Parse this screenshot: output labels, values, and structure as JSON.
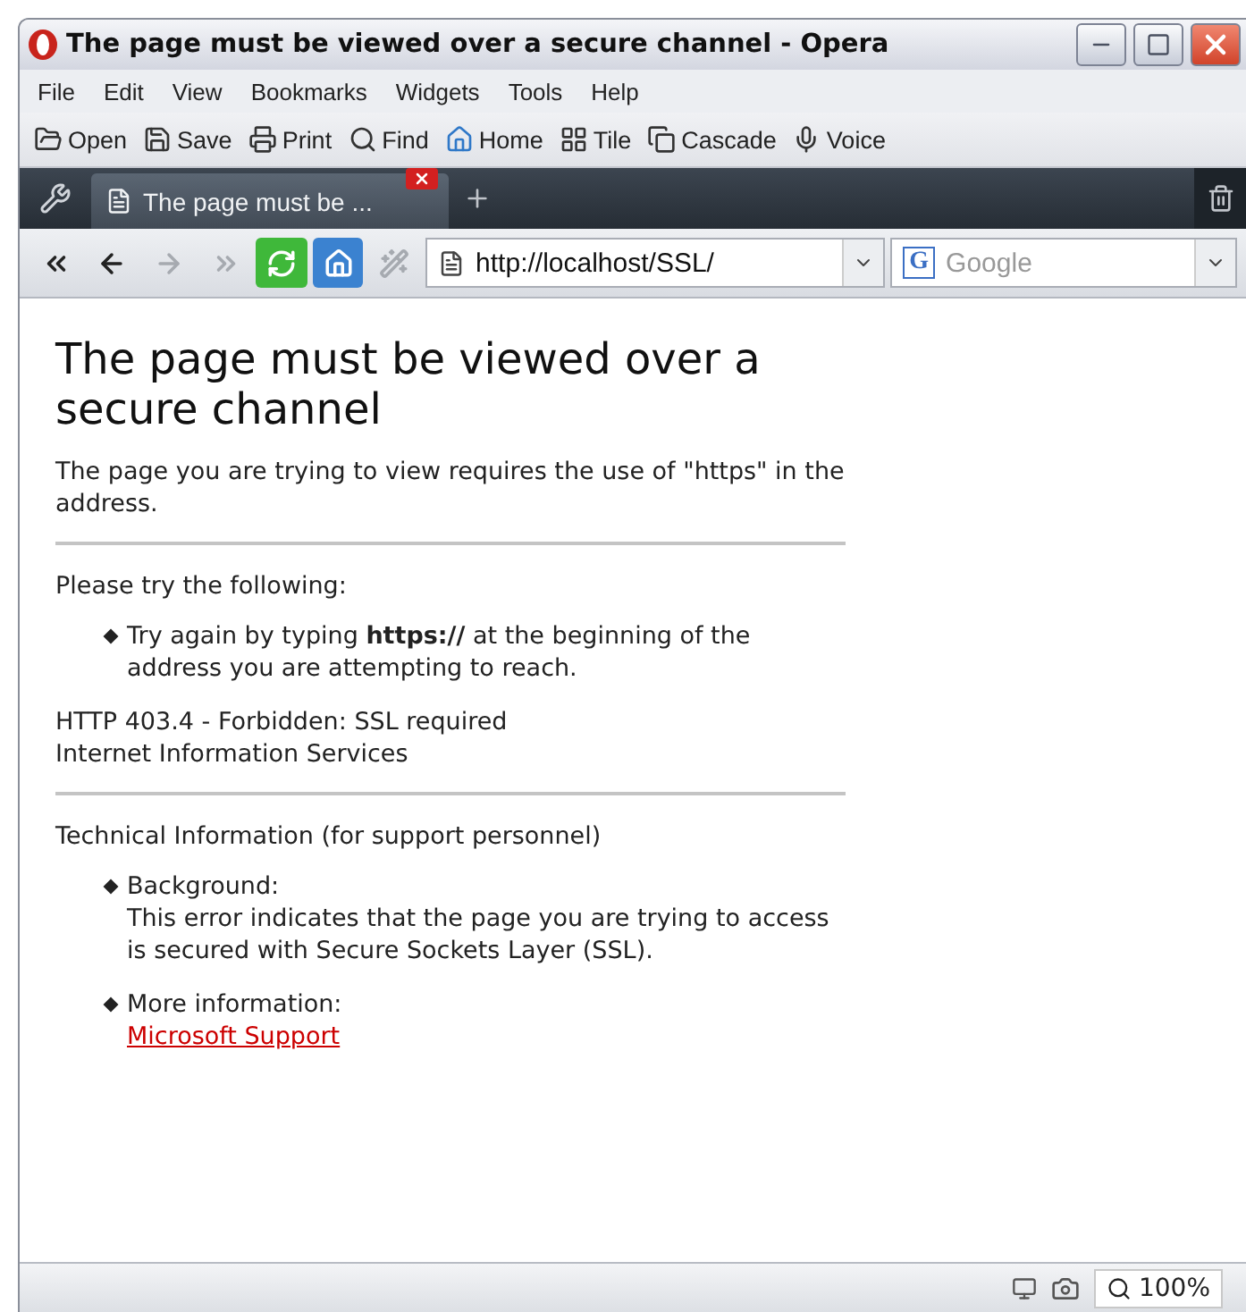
{
  "window": {
    "title": "The page must be viewed over a secure channel - Opera"
  },
  "menu": [
    "File",
    "Edit",
    "View",
    "Bookmarks",
    "Widgets",
    "Tools",
    "Help"
  ],
  "toolbar": [
    {
      "kind": "open",
      "label": "Open"
    },
    {
      "kind": "save",
      "label": "Save"
    },
    {
      "kind": "print",
      "label": "Print"
    },
    {
      "kind": "find",
      "label": "Find"
    },
    {
      "kind": "home",
      "label": "Home"
    },
    {
      "kind": "tile",
      "label": "Tile"
    },
    {
      "kind": "cascade",
      "label": "Cascade"
    },
    {
      "kind": "voice",
      "label": "Voice"
    }
  ],
  "tabs": [
    {
      "title": "The page must be ...",
      "selected": true
    }
  ],
  "nav_buttons": [
    {
      "kind": "rewind",
      "disabled": false
    },
    {
      "kind": "back",
      "disabled": false
    },
    {
      "kind": "forward",
      "disabled": true
    },
    {
      "kind": "fast-forward",
      "disabled": true
    },
    {
      "kind": "reload",
      "disabled": false
    },
    {
      "kind": "home",
      "disabled": false
    },
    {
      "kind": "wand",
      "disabled": true
    }
  ],
  "address": {
    "url": "http://localhost/SSL/"
  },
  "search": {
    "engine_icon": "G",
    "placeholder": "Google"
  },
  "page": {
    "heading": "The page must be viewed over a secure channel",
    "intro": "The page you are trying to view requires the use of \"https\" in the address.",
    "try_heading": "Please try the following:",
    "try_items": [
      "Try again by typing **https://** at the beginning of the address you are attempting to reach."
    ],
    "error_lines": [
      "HTTP 403.4 - Forbidden: SSL required",
      "Internet Information Services"
    ],
    "tech_heading": "Technical Information (for support personnel)",
    "tech_items": [
      {
        "label": "Background:",
        "text": "This error indicates that the page you are trying to access is secured with Secure Sockets Layer (SSL)."
      },
      {
        "label": "More information:",
        "link": "Microsoft Support"
      }
    ]
  },
  "status_bar": {
    "zoom": "100%"
  }
}
